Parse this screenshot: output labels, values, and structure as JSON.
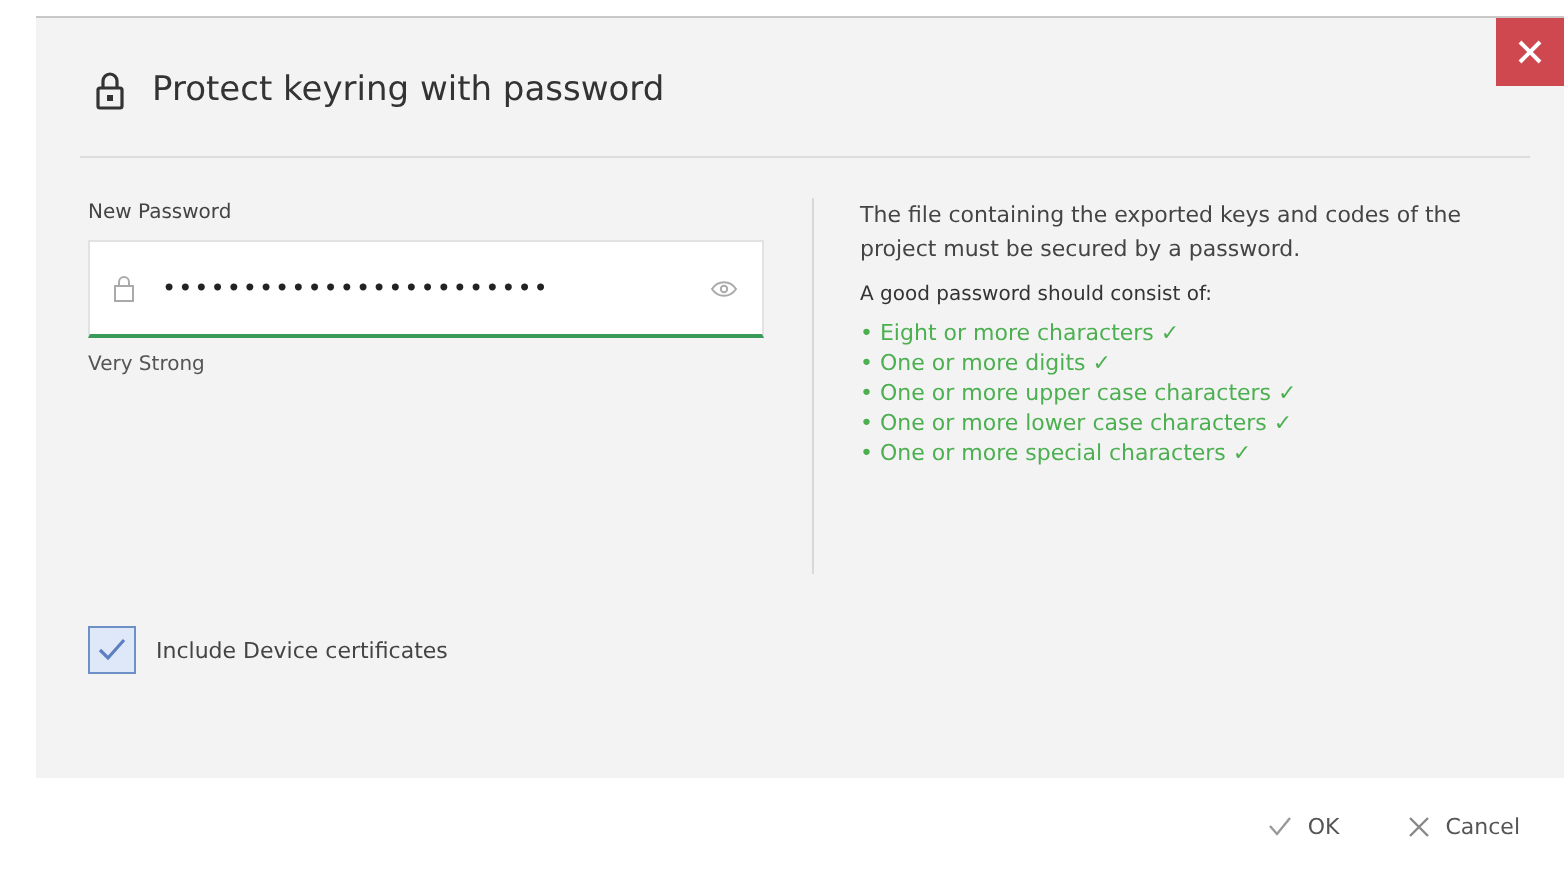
{
  "dialog": {
    "title": "Protect keyring with password"
  },
  "password": {
    "label": "New Password",
    "value": "••••••••••••••••••••••••",
    "strength": "Very Strong"
  },
  "info": {
    "intro": "The file containing the exported keys and codes of the project must be secured by a password.",
    "heading": "A good password should consist of:",
    "requirements": [
      {
        "text": "• Eight or more characters ✓",
        "met": true
      },
      {
        "text": "• One or more digits ✓",
        "met": true
      },
      {
        "text": "• One or more upper case characters ✓",
        "met": true
      },
      {
        "text": "• One or more lower case characters ✓",
        "met": true
      },
      {
        "text": "• One or more special characters ✓",
        "met": true
      }
    ]
  },
  "include_certificates": {
    "label": "Include Device certificates",
    "checked": true
  },
  "buttons": [
    {
      "kind": "ok",
      "label": "OK"
    },
    {
      "kind": "cancel",
      "label": "Cancel"
    }
  ]
}
